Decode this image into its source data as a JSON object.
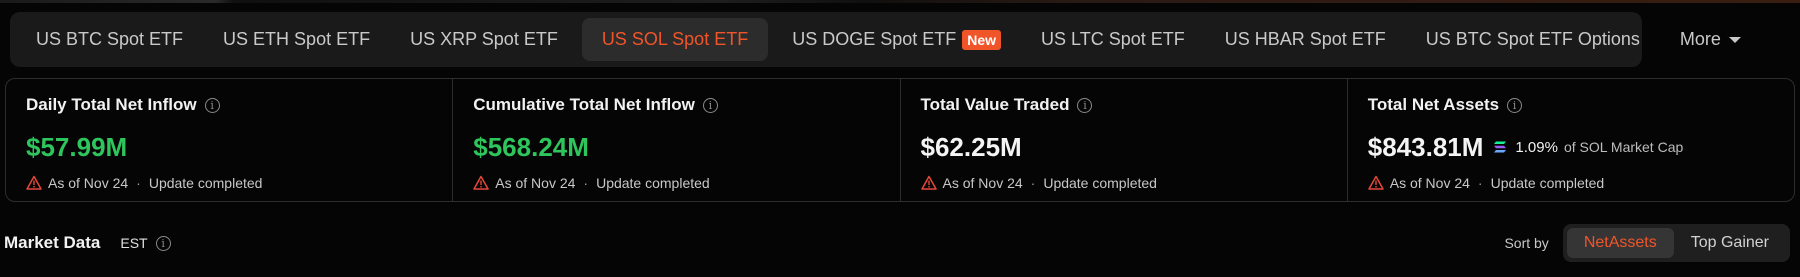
{
  "tabs": {
    "items": [
      {
        "label": "US BTC Spot ETF"
      },
      {
        "label": "US ETH Spot ETF"
      },
      {
        "label": "US XRP Spot ETF"
      },
      {
        "label": "US SOL Spot ETF",
        "active": true
      },
      {
        "label": "US DOGE Spot ETF",
        "badge": "New"
      },
      {
        "label": "US LTC Spot ETF"
      },
      {
        "label": "US HBAR Spot ETF"
      },
      {
        "label": "US BTC Spot ETF Options"
      }
    ],
    "more_label": "More"
  },
  "stats": [
    {
      "label": "Daily Total Net Inflow",
      "value": "$57.99M",
      "status_date": "As of Nov 24",
      "status_sep": "·",
      "status_text": "Update completed"
    },
    {
      "label": "Cumulative Total Net Inflow",
      "value": "$568.24M",
      "status_date": "As of Nov 24",
      "status_sep": "·",
      "status_text": "Update completed"
    },
    {
      "label": "Total Value Traded",
      "value": "$62.25M",
      "status_date": "As of Nov 24",
      "status_sep": "·",
      "status_text": "Update completed"
    },
    {
      "label": "Total Net Assets",
      "value": "$843.81M",
      "mcap_pct": "1.09%",
      "mcap_text": "of SOL Market Cap",
      "status_date": "As of Nov 24",
      "status_sep": "·",
      "status_text": "Update completed"
    }
  ],
  "market": {
    "title": "Market Data",
    "timezone": "EST"
  },
  "sort": {
    "label": "Sort by",
    "options": [
      {
        "label": "NetAssets",
        "active": true
      },
      {
        "label": "Top Gainer"
      }
    ]
  },
  "colors": {
    "accent": "#f0552a",
    "positive": "#2ec55c",
    "warning": "#e5483a",
    "background": "#050505"
  },
  "icons": {
    "info": "info-icon",
    "warning": "warning-triangle-icon",
    "caret": "caret-down-icon",
    "sol": "solana-icon"
  }
}
